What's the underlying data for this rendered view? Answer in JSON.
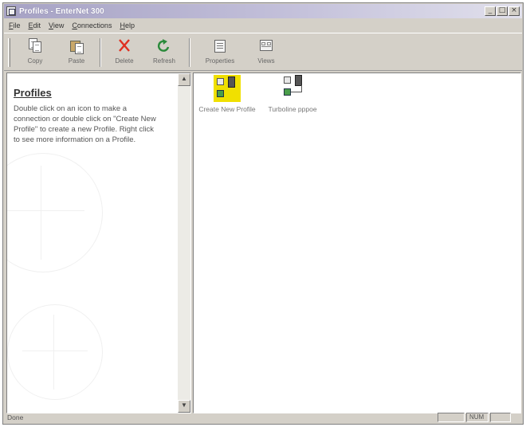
{
  "window": {
    "title": "Profiles - EnterNet 300"
  },
  "menu": {
    "items": [
      "File",
      "Edit",
      "View",
      "Connections",
      "Help"
    ]
  },
  "toolbar": {
    "copy_label": "Copy",
    "paste_label": "Paste",
    "delete_label": "Delete",
    "refresh_label": "Refresh",
    "properties_label": "Properties",
    "views_label": "Views"
  },
  "left_panel": {
    "heading": "Profiles",
    "description": "Double click on an icon to make a connection or double click on \"Create New Profile\" to create a new Profile.  Right click to see more information on a Profile."
  },
  "profiles": [
    {
      "label": "Create New Profile",
      "icon": "new-profile-icon"
    },
    {
      "label": "Turboline pppoe",
      "icon": "profile-connection-icon"
    }
  ],
  "status": {
    "text": "Done",
    "num_indicator": "NUM"
  },
  "colors": {
    "face": "#d4d0c8",
    "title_gradient_start": "#a6a2c4",
    "highlight_yellow": "#f0e000",
    "delete_red": "#e03020",
    "refresh_green": "#2a8a3a"
  }
}
